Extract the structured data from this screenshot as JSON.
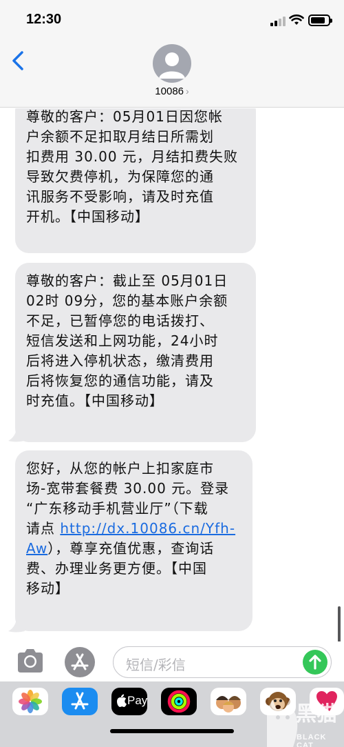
{
  "status_bar": {
    "time": "12:30",
    "battery_level": 0.85
  },
  "header": {
    "back_icon": "chevron-left-icon",
    "contact_name": "10086",
    "contact_chevron": "›",
    "accent_color": "#1a73e8"
  },
  "messages": [
    {
      "lines": [
        "尊敬的客户：05月01日因您帐",
        "户余额不足扣取月结日所需划",
        "扣费用 30.00 元，月结扣费失败",
        "导致欠费停机，为保障您的通",
        "讯服务不受影响，请及时充值",
        "开机。【中国移动】"
      ]
    },
    {
      "lines": [
        "尊敬的客户：截止至 05月01日",
        "02时 09分，您的基本账户余额",
        "不足，已暂停您的电话拨打、",
        "短信发送和上网功能，24小时",
        "后将进入停机状态，缴清费用",
        "后将恢复您的通信功能，请及",
        "时充值。【中国移动】"
      ]
    },
    {
      "line1": "您好，从您的帐户上扣家庭市",
      "line2": "场-宽带套餐费 30.00 元。登录",
      "line3": "“广东移动手机营业厅”（下载",
      "line4_prefix": "请点 ",
      "link_part1": "http://dx.10086.cn/Yfh-",
      "link_part2": "Aw",
      "line5_suffix": "），尊享充值优惠，查询话",
      "line6": "费、办理业务更方便。【中国",
      "line7": "移动】",
      "link_color": "#1a6be0"
    }
  ],
  "composer": {
    "placeholder": "短信/彩信",
    "send_color": "#34c759"
  },
  "app_drawer": {
    "apps": [
      {
        "name": "photos-app-icon"
      },
      {
        "name": "app-store-app-icon"
      },
      {
        "name": "apple-pay-app-icon",
        "label": "Pay"
      },
      {
        "name": "activity-app-icon"
      },
      {
        "name": "memoji-app-icon"
      },
      {
        "name": "animoji-app-icon"
      },
      {
        "name": "digital-touch-app-icon"
      }
    ]
  },
  "watermark": {
    "title": "黑猫",
    "subtitle": "BLACK CAT"
  }
}
